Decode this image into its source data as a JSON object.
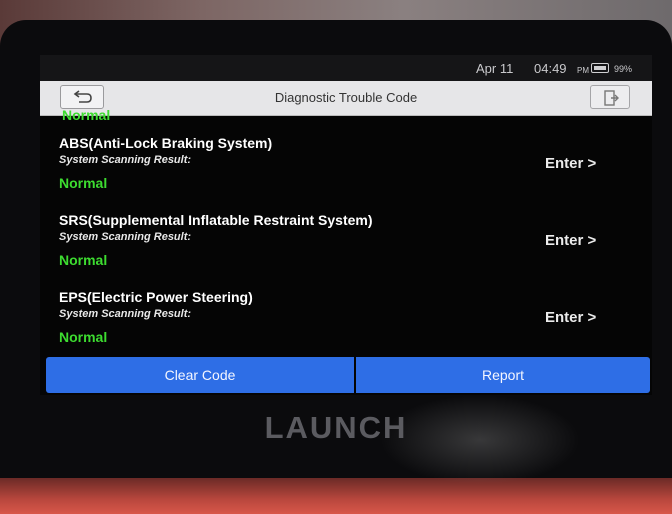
{
  "status_bar": {
    "date": "Apr 11",
    "time": "04:49",
    "ampm": "PM",
    "battery": "99%"
  },
  "header": {
    "title": "Diagnostic Trouble Code",
    "back_icon": "back-arrow-icon",
    "exit_icon": "exit-icon"
  },
  "list": {
    "partial_result": "Normal",
    "items": [
      {
        "name": "ABS(Anti-Lock Braking System)",
        "label": "System Scanning Result:",
        "result": "Normal",
        "action": "Enter >"
      },
      {
        "name": "SRS(Supplemental Inflatable Restraint System)",
        "label": "System Scanning Result:",
        "result": "Normal",
        "action": "Enter >"
      },
      {
        "name": "EPS(Electric Power Steering)",
        "label": "System Scanning Result:",
        "result": "Normal",
        "action": "Enter >"
      }
    ]
  },
  "footer": {
    "clear_code": "Clear Code",
    "report": "Report"
  },
  "device": {
    "brand": "LAUNCH"
  },
  "colors": {
    "accent": "#2e6ee6",
    "normal": "#3ddc30",
    "title_bar": "#e6e6e8"
  }
}
